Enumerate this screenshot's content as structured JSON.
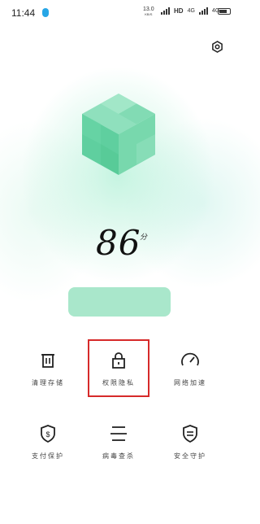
{
  "status_bar": {
    "time": "11:44",
    "net_speed_value": "13.0",
    "net_speed_unit": "KB/S",
    "hd_label": "HD",
    "signal1_label": "4G",
    "signal2_label": "4G",
    "battery": "battery-icon"
  },
  "header": {
    "settings_icon": "gear-icon"
  },
  "score": {
    "value": "86",
    "unit": "分"
  },
  "scan_button": {
    "label": ""
  },
  "grid": [
    {
      "id": "clean",
      "label": "清理存储",
      "icon": "trash-icon"
    },
    {
      "id": "privacy",
      "label": "权限隐私",
      "icon": "lock-icon"
    },
    {
      "id": "speed",
      "label": "网络加速",
      "icon": "speedometer-icon"
    },
    {
      "id": "payment",
      "label": "支付保护",
      "icon": "shield-dollar-icon"
    },
    {
      "id": "scan",
      "label": "病毒查杀",
      "icon": "scan-icon"
    },
    {
      "id": "guard",
      "label": "安全守护",
      "icon": "shield-list-icon"
    }
  ],
  "colors": {
    "accent": "#a9e7cb",
    "cube": "#5fcf9f",
    "highlight": "#d62a2a"
  }
}
